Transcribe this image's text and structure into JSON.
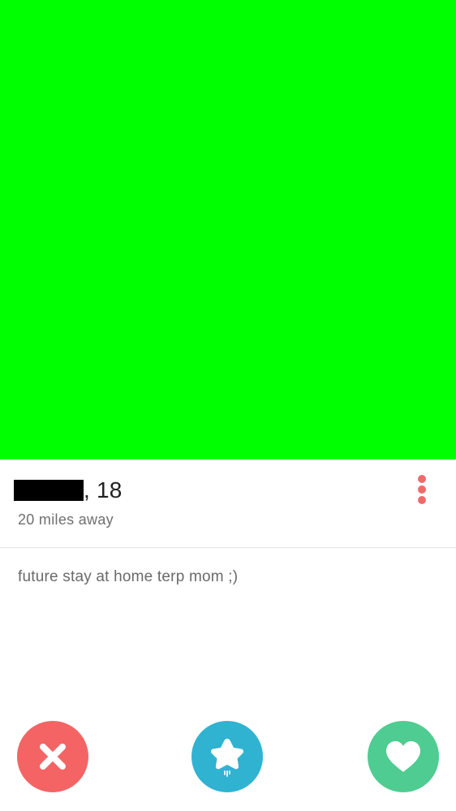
{
  "profile": {
    "age_text": ", 18",
    "distance": "20 miles away",
    "bio": "future stay at home terp mom ;)",
    "photo_color": "#00ff00",
    "redaction_color": "#000000"
  },
  "menu": {
    "icon": "more-vertical-icon",
    "color": "#ef6b6b"
  },
  "actions": {
    "nope": {
      "icon": "close-icon",
      "color": "#f46464"
    },
    "super_like": {
      "icon": "star-icon",
      "color": "#2fb3d1"
    },
    "like": {
      "icon": "heart-icon",
      "color": "#4fcc91"
    }
  }
}
